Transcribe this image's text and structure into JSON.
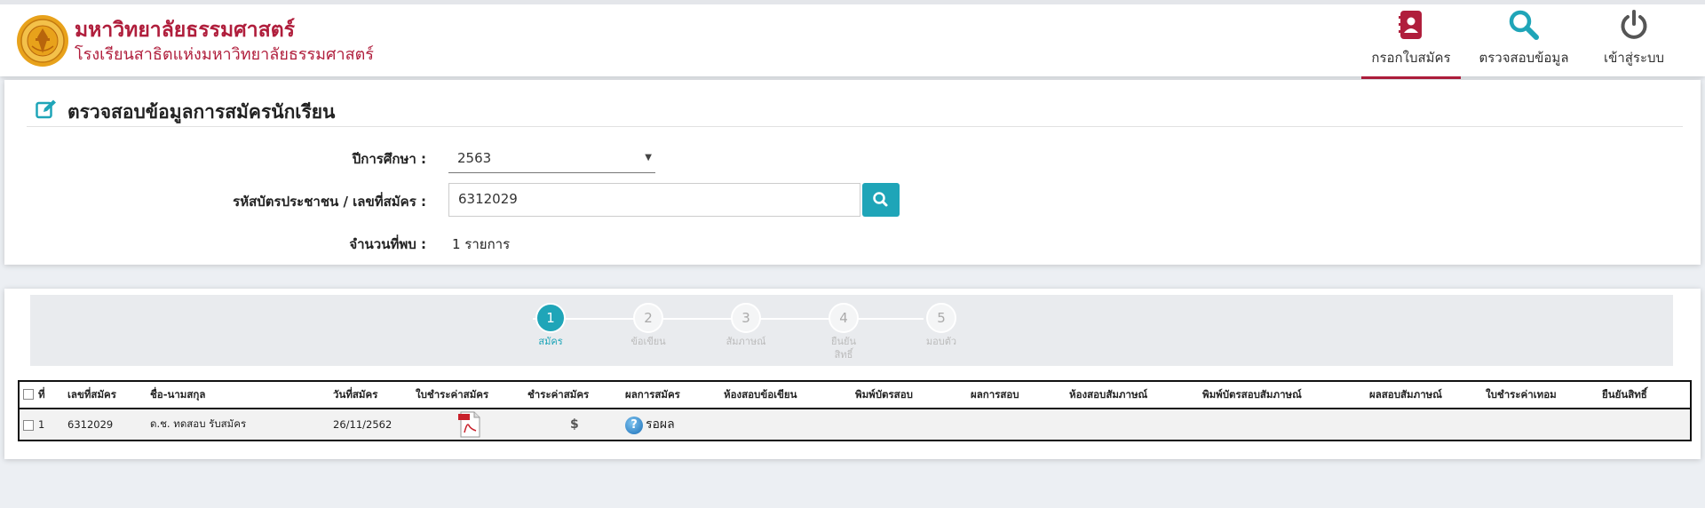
{
  "header": {
    "title": "มหาวิทยาลัยธรรมศาสตร์",
    "subtitle": "โรงเรียนสาธิตแห่งมหาวิทยาลัยธรรมศาสตร์",
    "nav": [
      {
        "label": "กรอกใบสมัคร",
        "icon": "contact-book-icon",
        "active": true
      },
      {
        "label": "ตรวจสอบข้อมูล",
        "icon": "search-icon",
        "active": false
      },
      {
        "label": "เข้าสู่ระบบ",
        "icon": "power-icon",
        "active": false
      }
    ],
    "colors": {
      "brand": "#b01e3c",
      "accent": "#1fa5b8"
    }
  },
  "search": {
    "title": "ตรวจสอบข้อมูลการสมัครนักเรียน",
    "year_label": "ปีการศึกษา :",
    "year_value": "2563",
    "id_label": "รหัสบัตรประชาชน / เลขที่สมัคร :",
    "id_value": "6312029",
    "count_label": "จำนวนที่พบ :",
    "count_value": "1 รายการ"
  },
  "steps": [
    {
      "number": "1",
      "label": "สมัคร",
      "active": true
    },
    {
      "number": "2",
      "label": "ข้อเขียน",
      "active": false
    },
    {
      "number": "3",
      "label": "สัมภาษณ์",
      "active": false
    },
    {
      "number": "4",
      "label": "ยืนยัน สิทธิ์",
      "active": false
    },
    {
      "number": "5",
      "label": "มอบตัว",
      "active": false
    }
  ],
  "table": {
    "headers": [
      "ที่",
      "เลขที่สมัคร",
      "ชื่อ-นามสกุล",
      "วันที่สมัคร",
      "ใบชำระค่าสมัคร",
      "ชำระค่าสมัคร",
      "ผลการสมัคร",
      "ห้องสอบข้อเขียน",
      "พิมพ์บัตรสอบ",
      "ผลการสอบ",
      "ห้องสอบสัมภาษณ์",
      "พิมพ์บัตรสอบสัมภาษณ์",
      "ผลสอบสัมภาษณ์",
      "ใบชำระค่าเทอม",
      "ยืนยันสิทธิ์"
    ],
    "rows": [
      {
        "no": "1",
        "app_no": "6312029",
        "name": "ด.ช. ทดสอบ รับสมัคร",
        "date": "26/11/2562",
        "payment_slip": "pdf-icon",
        "payment": "$",
        "result_icon": "?",
        "result": "รอผล"
      }
    ]
  }
}
